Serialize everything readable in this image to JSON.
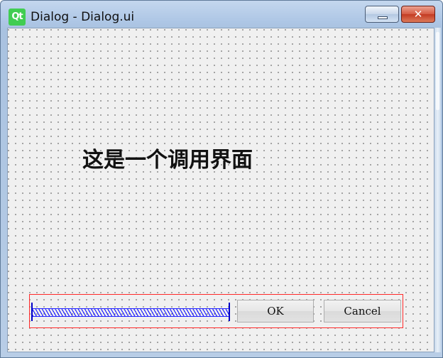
{
  "window": {
    "app_icon_text": "Qt",
    "title": "Dialog - Dialog.ui",
    "close_glyph": "✕"
  },
  "content": {
    "label": "这是一个调用界面"
  },
  "buttons": {
    "ok_label": "OK",
    "cancel_label": "Cancel"
  },
  "colors": {
    "layout_outline": "#ff2a2a",
    "spacer": "#2020ff",
    "qt_icon": "#41cd52"
  }
}
